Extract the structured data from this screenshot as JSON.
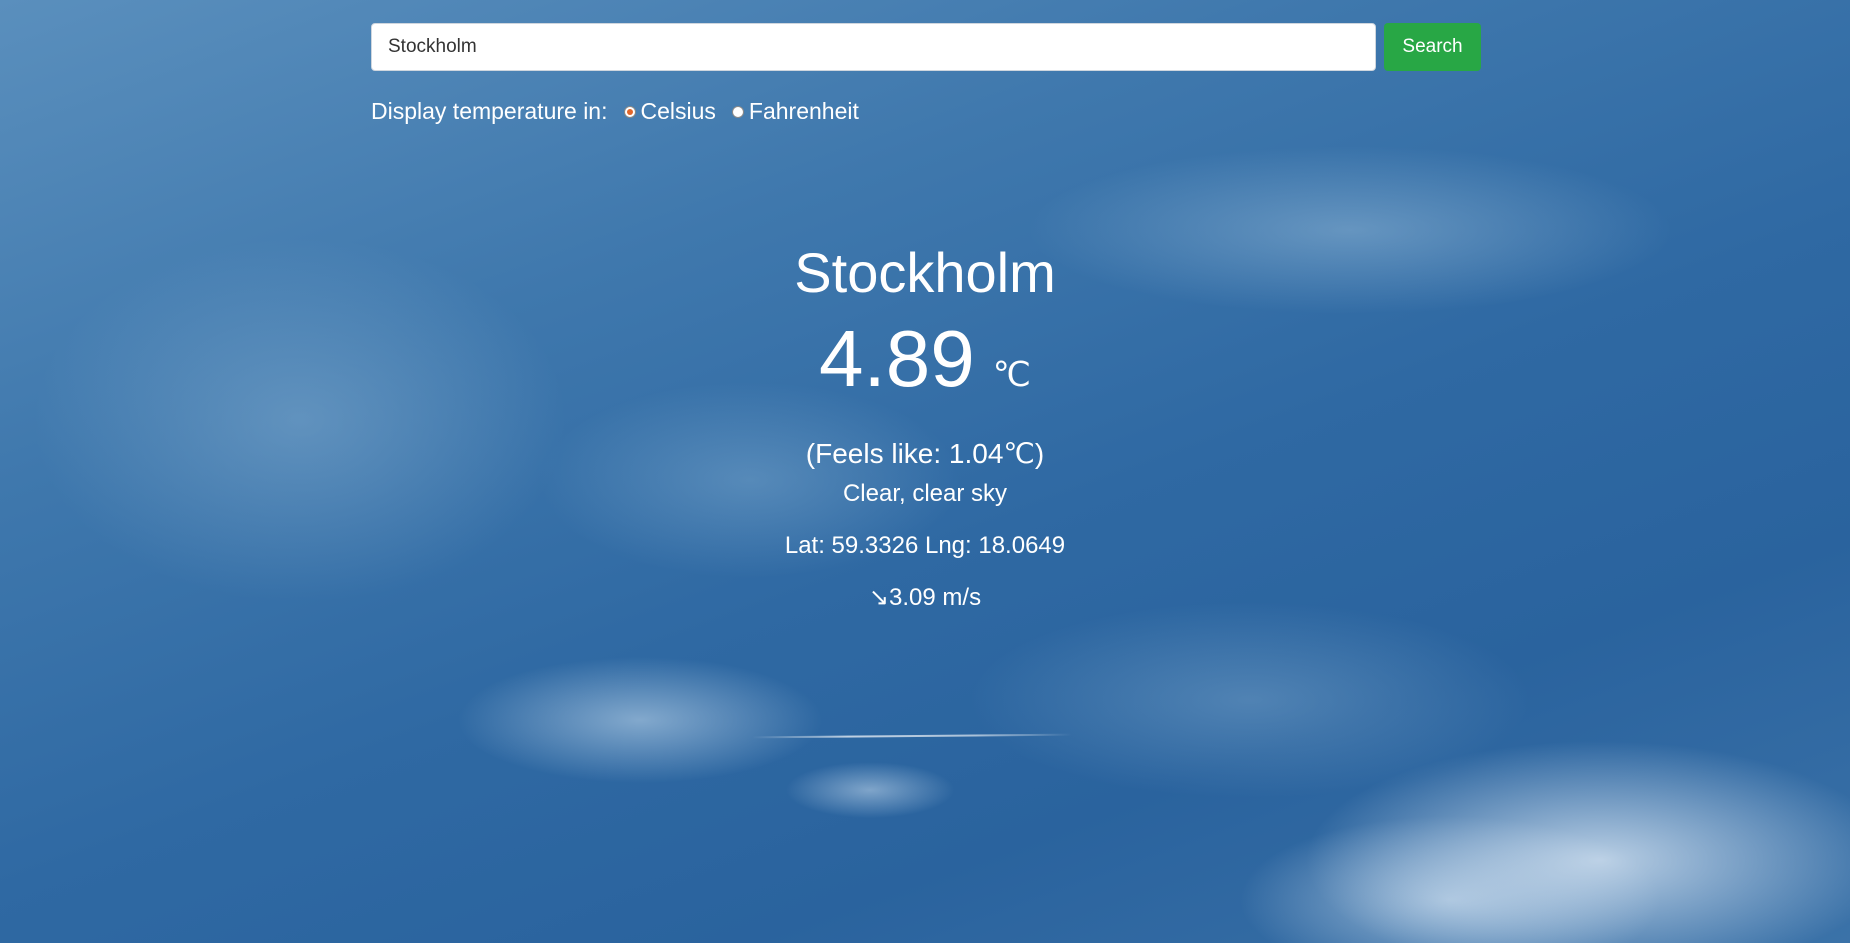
{
  "search": {
    "value": "Stockholm",
    "button_label": "Search"
  },
  "units": {
    "label": "Display temperature in:",
    "options": [
      {
        "label": "Celsius",
        "checked": true
      },
      {
        "label": "Fahrenheit",
        "checked": false
      }
    ]
  },
  "weather": {
    "city": "Stockholm",
    "temperature": "4.89",
    "unit": "℃",
    "feels_like": "(Feels like: 1.04℃)",
    "description": "Clear, clear sky",
    "coordinates": "Lat: 59.3326 Lng: 18.0649",
    "wind_arrow": "↘",
    "wind_speed": "3.09 m/s"
  },
  "colors": {
    "search_button": "#28a745",
    "radio_checked": "#e2662a",
    "sky": "#2f69a3"
  }
}
